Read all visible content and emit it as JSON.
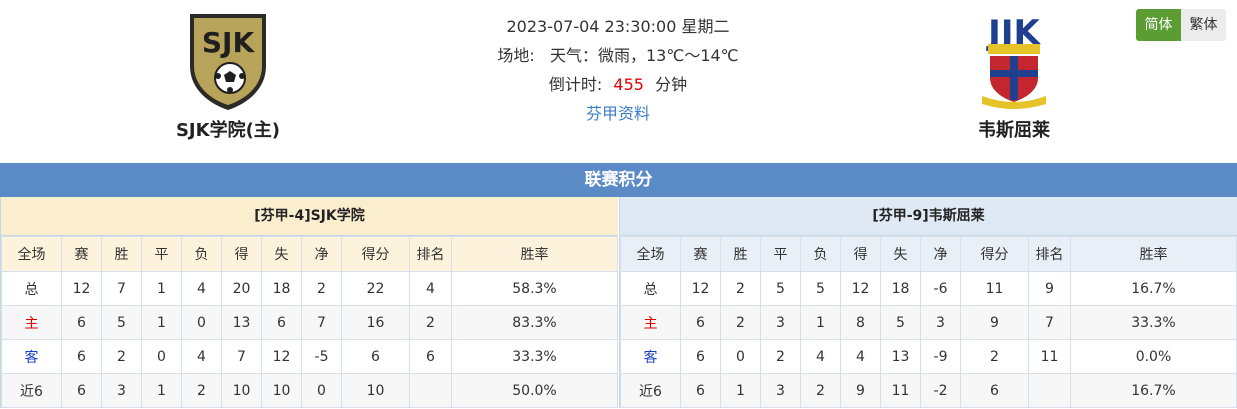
{
  "match": {
    "datetime": "2023-07-04 23:30:00 星期二",
    "venue_weather": "场地:   天气：微雨，13℃～14℃",
    "countdown_label": "倒计时:",
    "countdown_value": "455",
    "countdown_unit": "分钟",
    "league_link": "芬甲资料"
  },
  "home_team": {
    "name": "SJK学院(主)",
    "logo_text": "SJK"
  },
  "away_team": {
    "name": "韦斯屈莱",
    "logo_text": "JJK"
  },
  "lang": {
    "simplified": "简体",
    "traditional": "繁体"
  },
  "section_title": "联赛积分",
  "columns": [
    "全场",
    "赛",
    "胜",
    "平",
    "负",
    "得",
    "失",
    "净",
    "得分",
    "排名",
    "胜率"
  ],
  "home_standings": {
    "title": "[芬甲-4]SJK学院",
    "rows": [
      [
        "总",
        "12",
        "7",
        "1",
        "4",
        "20",
        "18",
        "2",
        "22",
        "4",
        "58.3%"
      ],
      [
        "主",
        "6",
        "5",
        "1",
        "0",
        "13",
        "6",
        "7",
        "16",
        "2",
        "83.3%"
      ],
      [
        "客",
        "6",
        "2",
        "0",
        "4",
        "7",
        "12",
        "-5",
        "6",
        "6",
        "33.3%"
      ],
      [
        "近6",
        "6",
        "3",
        "1",
        "2",
        "10",
        "10",
        "0",
        "10",
        "",
        "50.0%"
      ]
    ]
  },
  "away_standings": {
    "title": "[芬甲-9]韦斯屈莱",
    "rows": [
      [
        "总",
        "12",
        "2",
        "5",
        "5",
        "12",
        "18",
        "-6",
        "11",
        "9",
        "16.7%"
      ],
      [
        "主",
        "6",
        "2",
        "3",
        "1",
        "8",
        "5",
        "3",
        "9",
        "7",
        "33.3%"
      ],
      [
        "客",
        "6",
        "0",
        "2",
        "4",
        "4",
        "13",
        "-9",
        "2",
        "11",
        "0.0%"
      ],
      [
        "近6",
        "6",
        "1",
        "3",
        "2",
        "9",
        "11",
        "-2",
        "6",
        "",
        "16.7%"
      ]
    ]
  },
  "colors": {
    "accent_blue": "#5b8bc6",
    "home_red": "#e10000",
    "away_blue": "#1e3fc4",
    "lang_green": "#5b9d32"
  }
}
